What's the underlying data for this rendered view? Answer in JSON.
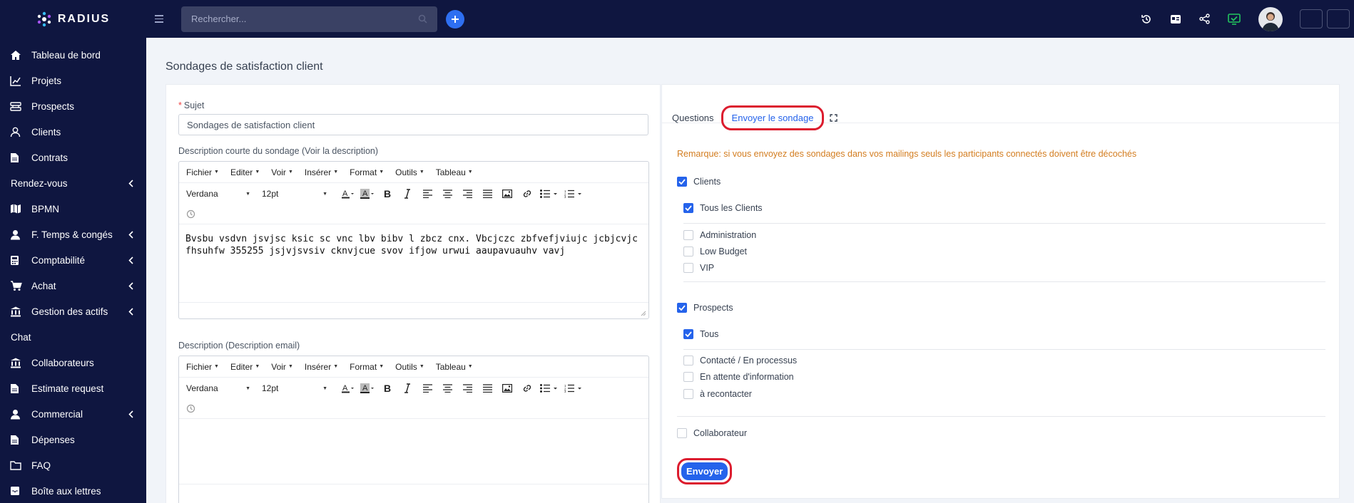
{
  "app": {
    "logo_text": "RADIUS",
    "accent": "#2563eb",
    "nav_bg": "#0f1640"
  },
  "search": {
    "placeholder": "Rechercher..."
  },
  "sidebar": {
    "items": [
      {
        "label": "Tableau de bord",
        "icon": "home-icon"
      },
      {
        "label": "Projets",
        "icon": "chart-icon"
      },
      {
        "label": "Prospects",
        "icon": "prospects-icon"
      },
      {
        "label": "Clients",
        "icon": "user-icon"
      },
      {
        "label": "Contrats",
        "icon": "document-icon"
      },
      {
        "label": "Rendez-vous",
        "icon": ""
      },
      {
        "label": "BPMN",
        "icon": "map-icon"
      },
      {
        "label": "F. Temps & congés",
        "icon": "user-circle-icon"
      },
      {
        "label": "Comptabilité",
        "icon": "calculator-icon"
      },
      {
        "label": "Achat",
        "icon": "cart-icon"
      },
      {
        "label": "Gestion des actifs",
        "icon": "bank-icon"
      },
      {
        "label": "Chat",
        "icon": ""
      },
      {
        "label": "Collaborateurs",
        "icon": "bank-icon"
      },
      {
        "label": "Estimate request",
        "icon": "document-icon"
      },
      {
        "label": "Commercial",
        "icon": "user-circle-icon"
      },
      {
        "label": "Dépenses",
        "icon": "document-icon"
      },
      {
        "label": "FAQ",
        "icon": "folder-icon"
      },
      {
        "label": "Boîte aux lettres",
        "icon": "mail-icon"
      }
    ]
  },
  "page": {
    "title": "Sondages de satisfaction client"
  },
  "form": {
    "subject_label": "Sujet",
    "subject_value": "Sondages de satisfaction client",
    "short_desc_label": "Description courte du sondage (Voir la description)",
    "desc_label": "Description (Description email)",
    "short_desc_content": "Bvsbu vsdvn jsvjsc ksic sc vnc lbv bibv l zbcz cnx. Vbcjczc zbfvefjviujc jcbjcvjc fhsuhfw 355255 jsjvjsvsiv  cknvjcue svov ifjow  urwui aaupavuauhv vavj"
  },
  "editor": {
    "menus": [
      "Fichier",
      "Editer",
      "Voir",
      "Insérer",
      "Format",
      "Outils",
      "Tableau"
    ],
    "font": "Verdana",
    "size": "12pt"
  },
  "tabs": {
    "questions": "Questions",
    "send": "Envoyer le sondage"
  },
  "send_panel": {
    "note": "Remarque: si vous envoyez des sondages dans vos mailings seuls les participants connectés doivent être décochés",
    "clients": "Clients",
    "all_clients": "Tous les Clients",
    "client_groups": [
      "Administration",
      "Low Budget",
      "VIP"
    ],
    "prospects": "Prospects",
    "all_prospects": "Tous",
    "prospect_statuses": [
      "Contacté / En processus",
      "En attente d'information",
      "à recontacter"
    ],
    "collaborator": "Collaborateur",
    "send_button": "Envoyer"
  }
}
